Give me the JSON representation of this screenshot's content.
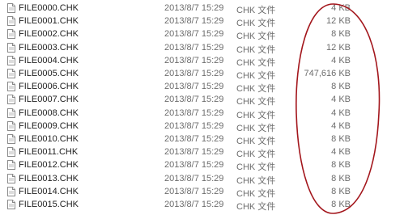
{
  "file_list": {
    "type_icon": "document-icon",
    "rows": [
      {
        "name": "FILE0000.CHK",
        "modified": "2013/8/7 15:29",
        "type": "CHK 文件",
        "size": "4 KB"
      },
      {
        "name": "FILE0001.CHK",
        "modified": "2013/8/7 15:29",
        "type": "CHK 文件",
        "size": "12 KB"
      },
      {
        "name": "FILE0002.CHK",
        "modified": "2013/8/7 15:29",
        "type": "CHK 文件",
        "size": "8 KB"
      },
      {
        "name": "FILE0003.CHK",
        "modified": "2013/8/7 15:29",
        "type": "CHK 文件",
        "size": "12 KB"
      },
      {
        "name": "FILE0004.CHK",
        "modified": "2013/8/7 15:29",
        "type": "CHK 文件",
        "size": "4 KB"
      },
      {
        "name": "FILE0005.CHK",
        "modified": "2013/8/7 15:29",
        "type": "CHK 文件",
        "size": "747,616 KB"
      },
      {
        "name": "FILE0006.CHK",
        "modified": "2013/8/7 15:29",
        "type": "CHK 文件",
        "size": "8 KB"
      },
      {
        "name": "FILE0007.CHK",
        "modified": "2013/8/7 15:29",
        "type": "CHK 文件",
        "size": "4 KB"
      },
      {
        "name": "FILE0008.CHK",
        "modified": "2013/8/7 15:29",
        "type": "CHK 文件",
        "size": "4 KB"
      },
      {
        "name": "FILE0009.CHK",
        "modified": "2013/8/7 15:29",
        "type": "CHK 文件",
        "size": "4 KB"
      },
      {
        "name": "FILE0010.CHK",
        "modified": "2013/8/7 15:29",
        "type": "CHK 文件",
        "size": "8 KB"
      },
      {
        "name": "FILE0011.CHK",
        "modified": "2013/8/7 15:29",
        "type": "CHK 文件",
        "size": "4 KB"
      },
      {
        "name": "FILE0012.CHK",
        "modified": "2013/8/7 15:29",
        "type": "CHK 文件",
        "size": "8 KB"
      },
      {
        "name": "FILE0013.CHK",
        "modified": "2013/8/7 15:29",
        "type": "CHK 文件",
        "size": "8 KB"
      },
      {
        "name": "FILE0014.CHK",
        "modified": "2013/8/7 15:29",
        "type": "CHK 文件",
        "size": "8 KB"
      },
      {
        "name": "FILE0015.CHK",
        "modified": "2013/8/7 15:29",
        "type": "CHK 文件",
        "size": "8 KB"
      }
    ]
  },
  "annotation": {
    "shape": "ellipse",
    "color": "#a3161c"
  }
}
